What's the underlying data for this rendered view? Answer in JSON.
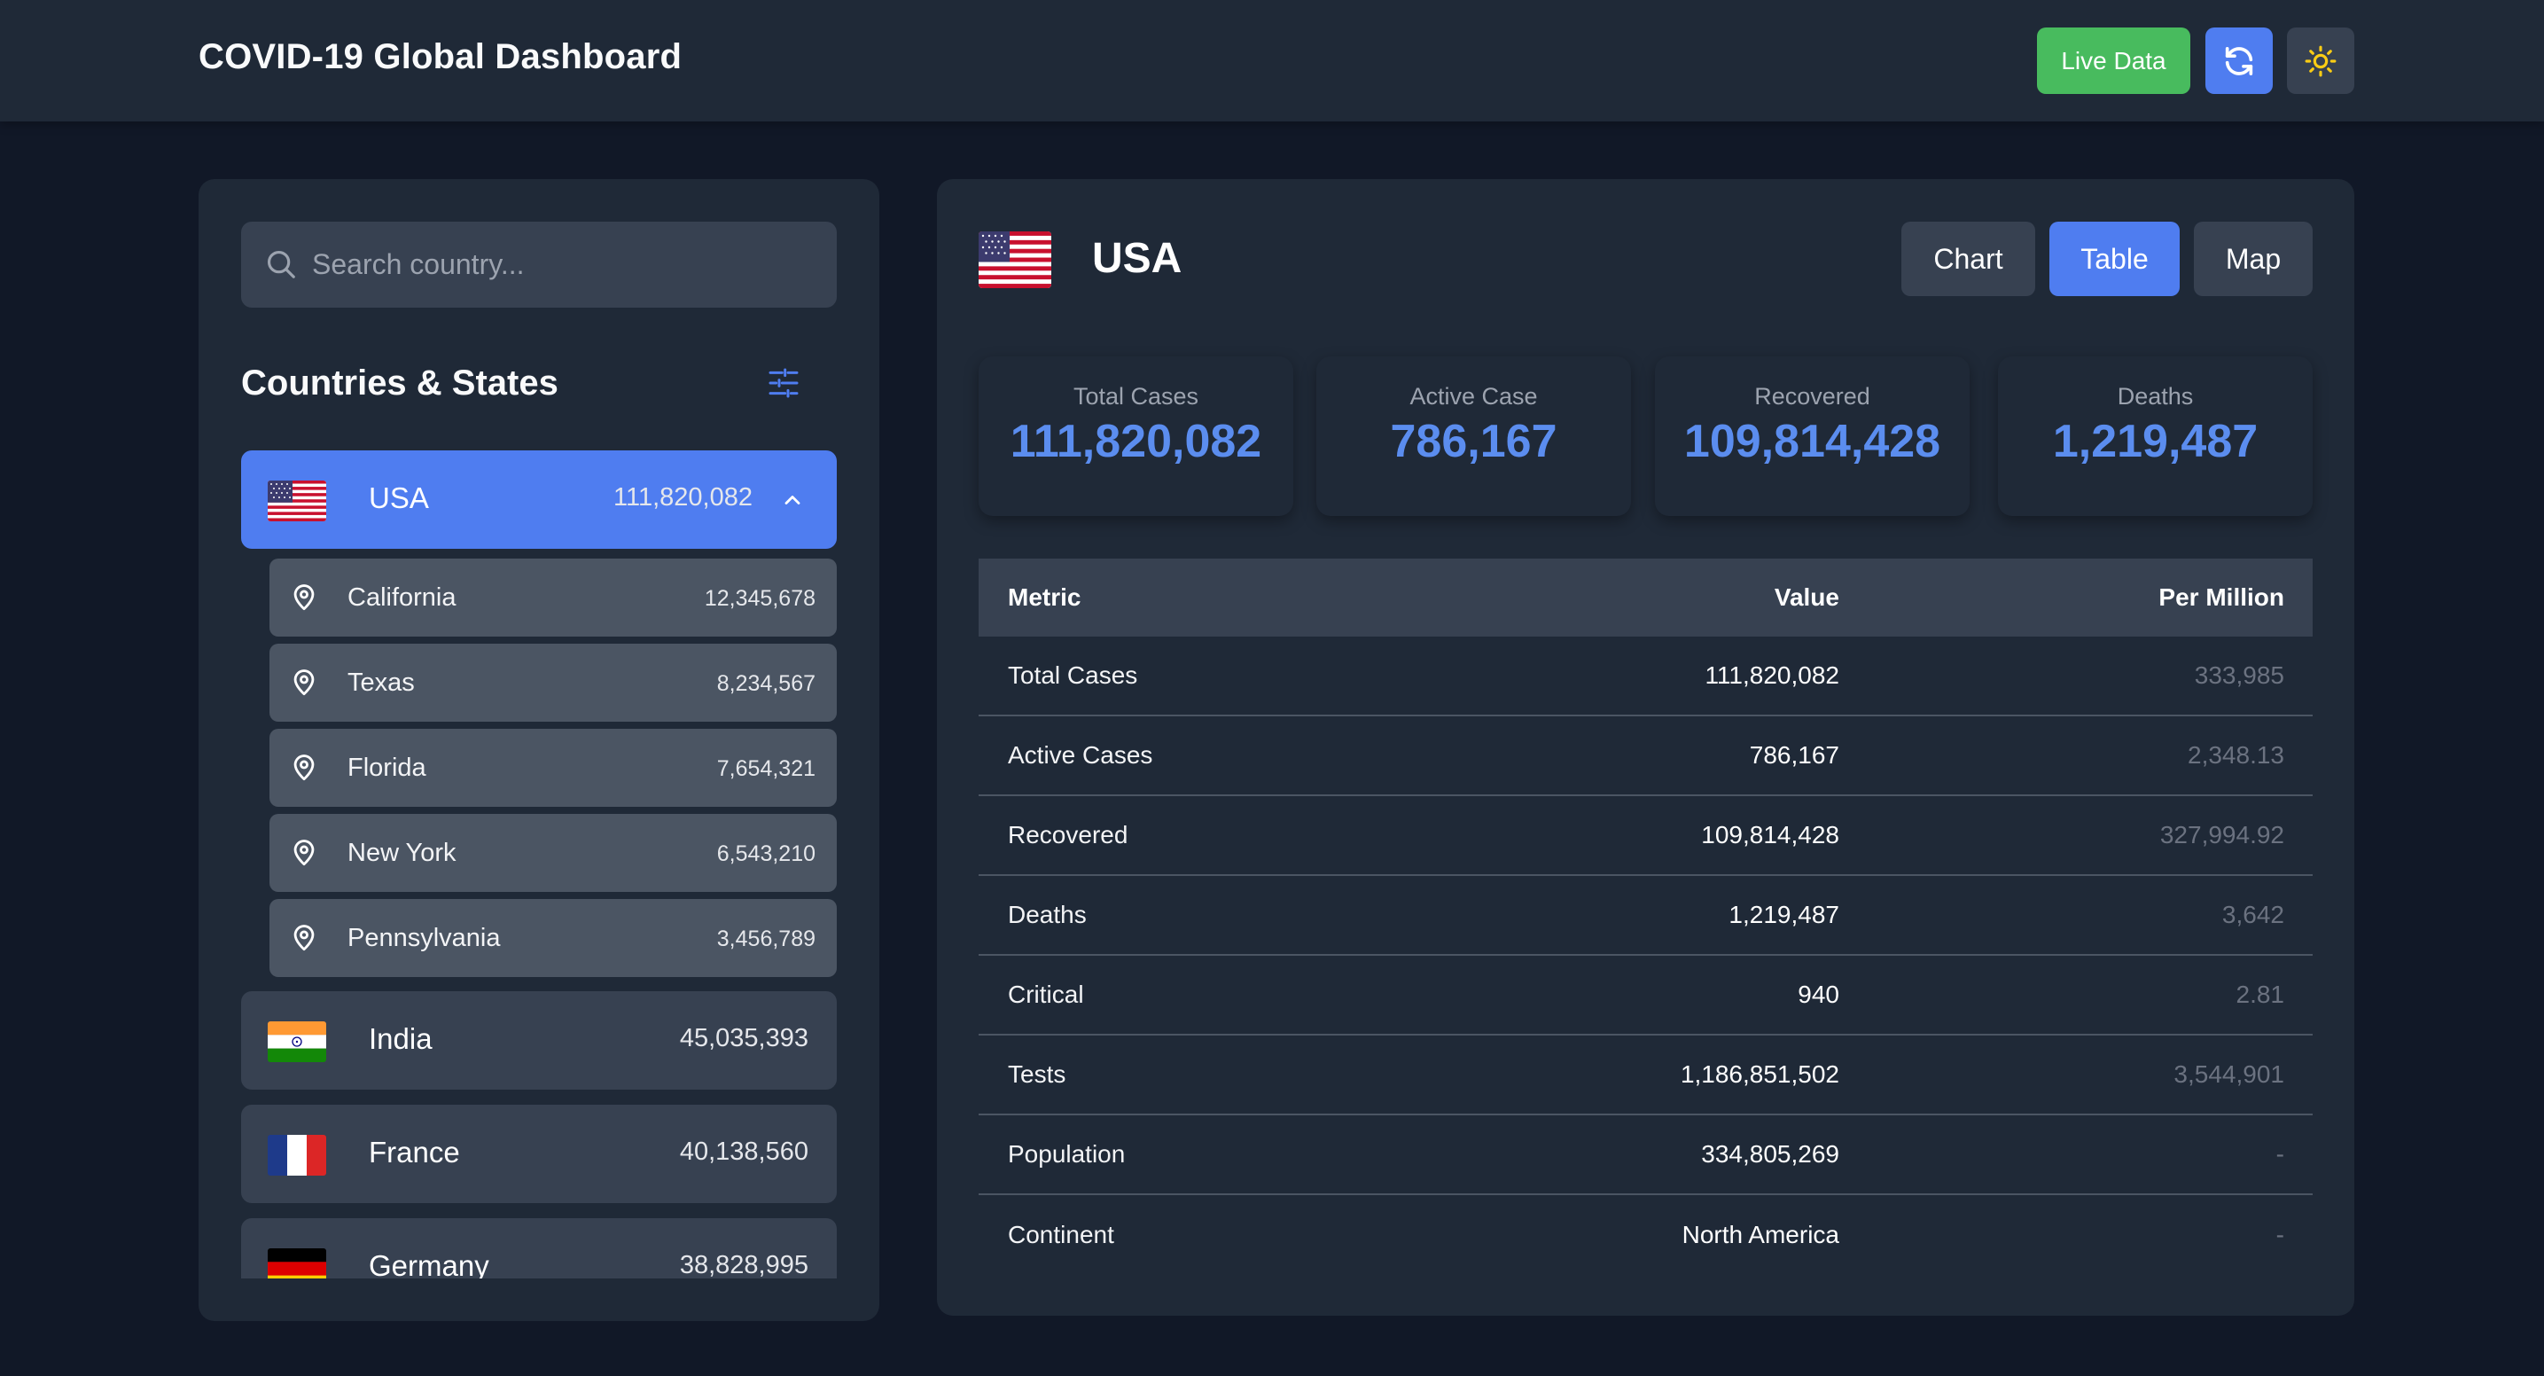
{
  "header": {
    "title": "COVID-19 Global Dashboard",
    "live_label": "Live Data"
  },
  "sidebar": {
    "search_placeholder": "Search country...",
    "section_title": "Countries & States",
    "countries": [
      {
        "name": "USA",
        "count": "111,820,082",
        "flag": "us-flag",
        "expanded": true
      },
      {
        "name": "India",
        "count": "45,035,393",
        "flag": "india-flag"
      },
      {
        "name": "France",
        "count": "40,138,560",
        "flag": "france-flag"
      },
      {
        "name": "Germany",
        "count": "38,828,995",
        "flag": "germany-flag"
      }
    ],
    "states": [
      {
        "name": "California",
        "count": "12,345,678"
      },
      {
        "name": "Texas",
        "count": "8,234,567"
      },
      {
        "name": "Florida",
        "count": "7,654,321"
      },
      {
        "name": "New York",
        "count": "6,543,210"
      },
      {
        "name": "Pennsylvania",
        "count": "3,456,789"
      }
    ]
  },
  "main": {
    "country": "USA",
    "views": [
      {
        "label": "Chart",
        "active": false
      },
      {
        "label": "Table",
        "active": true
      },
      {
        "label": "Map",
        "active": false
      }
    ],
    "stats": [
      {
        "label": "Total Cases",
        "value": "111,820,082"
      },
      {
        "label": "Active Case",
        "value": "786,167"
      },
      {
        "label": "Recovered",
        "value": "109,814,428"
      },
      {
        "label": "Deaths",
        "value": "1,219,487"
      }
    ],
    "table": {
      "headers": [
        "Metric",
        "Value",
        "Per Million"
      ],
      "rows": [
        [
          "Total Cases",
          "111,820,082",
          "333,985"
        ],
        [
          "Active Cases",
          "786,167",
          "2,348.13"
        ],
        [
          "Recovered",
          "109,814,428",
          "327,994.92"
        ],
        [
          "Deaths",
          "1,219,487",
          "3,642"
        ],
        [
          "Critical",
          "940",
          "2.81"
        ],
        [
          "Tests",
          "1,186,851,502",
          "3,544,901"
        ],
        [
          "Population",
          "334,805,269",
          "-"
        ],
        [
          "Continent",
          "North America",
          "-"
        ]
      ]
    }
  },
  "colors": {
    "background": "#111827",
    "panel": "#1f2937",
    "accent": "#4f7df0",
    "live": "#48bb5e",
    "stat_value": "#5b8def"
  }
}
